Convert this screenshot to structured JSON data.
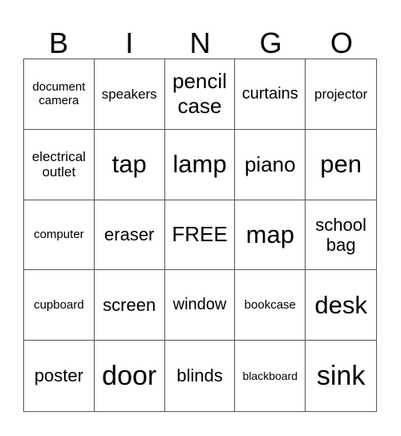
{
  "card": {
    "header_letters": [
      "B",
      "I",
      "N",
      "G",
      "O"
    ],
    "cells": [
      [
        {
          "text": "document camera",
          "size": "fs-s"
        },
        {
          "text": "speakers",
          "size": "fs-sm"
        },
        {
          "text": "pencil case",
          "size": "fs-l"
        },
        {
          "text": "curtains",
          "size": "fs-m"
        },
        {
          "text": "projector",
          "size": "fs-sm"
        }
      ],
      [
        {
          "text": "electrical outlet",
          "size": "fs-sm"
        },
        {
          "text": "tap",
          "size": "fs-xl"
        },
        {
          "text": "lamp",
          "size": "fs-xl"
        },
        {
          "text": "piano",
          "size": "fs-l"
        },
        {
          "text": "pen",
          "size": "fs-xl"
        }
      ],
      [
        {
          "text": "computer",
          "size": "fs-s"
        },
        {
          "text": "eraser",
          "size": "fs-ml"
        },
        {
          "text": "FREE",
          "size": "fs-l"
        },
        {
          "text": "map",
          "size": "fs-xl"
        },
        {
          "text": "school bag",
          "size": "fs-ml"
        }
      ],
      [
        {
          "text": "cupboard",
          "size": "fs-s"
        },
        {
          "text": "screen",
          "size": "fs-ml"
        },
        {
          "text": "window",
          "size": "fs-m"
        },
        {
          "text": "bookcase",
          "size": "fs-s"
        },
        {
          "text": "desk",
          "size": "fs-xl"
        }
      ],
      [
        {
          "text": "poster",
          "size": "fs-ml"
        },
        {
          "text": "door",
          "size": "fs-xxl"
        },
        {
          "text": "blinds",
          "size": "fs-ml"
        },
        {
          "text": "blackboard",
          "size": "fs-xs"
        },
        {
          "text": "sink",
          "size": "fs-xxl"
        }
      ]
    ]
  }
}
